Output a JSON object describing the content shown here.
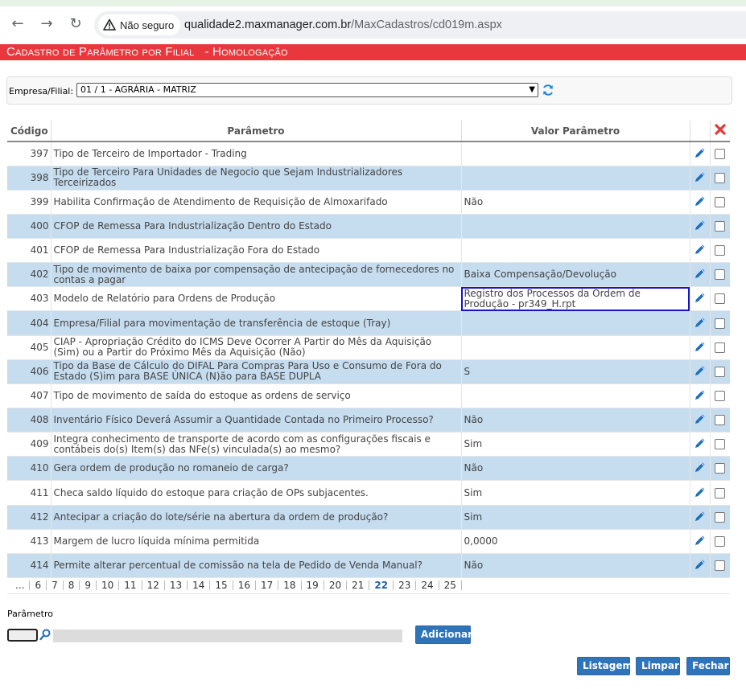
{
  "browser": {
    "security_label": "Não seguro",
    "url_host": "qualidade2.maxmanager.com.br",
    "url_path": "/MaxCadastros/cd019m.aspx"
  },
  "page": {
    "title": "Cadastro de Parâmetro por Filial   - Homologação"
  },
  "filter": {
    "label": "Empresa/Filial:",
    "selected": "01 / 1 - AGRÁRIA - MATRIZ"
  },
  "grid": {
    "headers": {
      "codigo": "Código",
      "parametro": "Parâmetro",
      "valor": "Valor Parâmetro"
    },
    "rows": [
      {
        "code": "397",
        "param": "Tipo de Terceiro de Importador - Trading",
        "value": ""
      },
      {
        "code": "398",
        "param": "Tipo de Terceiro Para Unidades de Negocio que Sejam Industrializadores Terceirizados",
        "value": ""
      },
      {
        "code": "399",
        "param": "Habilita Confirmação de Atendimento de Requisição de Almoxarifado",
        "value": "Não"
      },
      {
        "code": "400",
        "param": "CFOP de Remessa Para Industrialização Dentro do Estado",
        "value": ""
      },
      {
        "code": "401",
        "param": "CFOP de Remessa Para Industrialização Fora do Estado",
        "value": ""
      },
      {
        "code": "402",
        "param": "Tipo de movimento de baixa por compensação de antecipação de fornecedores no contas a pagar",
        "value": "Baixa Compensação/Devolução"
      },
      {
        "code": "403",
        "param": "Modelo de Relatório para Ordens de Produção",
        "value": "Registro dos Processos da Ordem de Produção - pr349_H.rpt"
      },
      {
        "code": "404",
        "param": "Empresa/Filial para movimentação de transferência de estoque (Tray)",
        "value": ""
      },
      {
        "code": "405",
        "param": "CIAP - Apropriação Crédito do ICMS Deve Ocorrer A Partir do Mês da Aquisição (Sim) ou a Partir do Próximo Mês da Aquisição (Não)",
        "value": ""
      },
      {
        "code": "406",
        "param": "Tipo da Base de Cálculo do DIFAL Para Compras Para Uso e Consumo de Fora do Estado (S)im para BASE ÚNICA (N)ão para BASE DUPLA",
        "value": "S"
      },
      {
        "code": "407",
        "param": "Tipo de movimento de saída do estoque as ordens de serviço",
        "value": ""
      },
      {
        "code": "408",
        "param": "Inventário Físico Deverá Assumir a Quantidade Contada no Primeiro Processo?",
        "value": "Não"
      },
      {
        "code": "409",
        "param": "Integra conhecimento de transporte de acordo com as configurações fiscais e contábeis do(s) Item(s) das NFe(s) vinculada(s) ao mesmo?",
        "value": "Sim"
      },
      {
        "code": "410",
        "param": "Gera ordem de produção no romaneio de carga?",
        "value": "Não"
      },
      {
        "code": "411",
        "param": "Checa saldo líquido do estoque para criação de OPs subjacentes.",
        "value": "Sim"
      },
      {
        "code": "412",
        "param": "Antecipar a criação do lote/série na abertura da ordem de produção?",
        "value": "Sim"
      },
      {
        "code": "413",
        "param": "Margem de lucro líquida mínima permitida",
        "value": "0,0000"
      },
      {
        "code": "414",
        "param": "Permite alterar percentual de comissão na tela de Pedido de Venda Manual?",
        "value": "Não"
      }
    ],
    "pager": [
      "...",
      "6",
      "7",
      "8",
      "9",
      "10",
      "11",
      "12",
      "13",
      "14",
      "15",
      "16",
      "17",
      "18",
      "19",
      "20",
      "21",
      "22",
      "23",
      "24",
      "25"
    ],
    "current_page": "22"
  },
  "form": {
    "param_label": "Parâmetro",
    "add_label": "Adicionar"
  },
  "actions": {
    "listagem": "Listagem",
    "limpar": "Limpar",
    "fechar": "Fechar"
  },
  "colors": {
    "title_bar": "#e8383d",
    "row_alt": "#c6dcef",
    "button": "#2f73b8",
    "highlight_border": "#1515c8"
  }
}
